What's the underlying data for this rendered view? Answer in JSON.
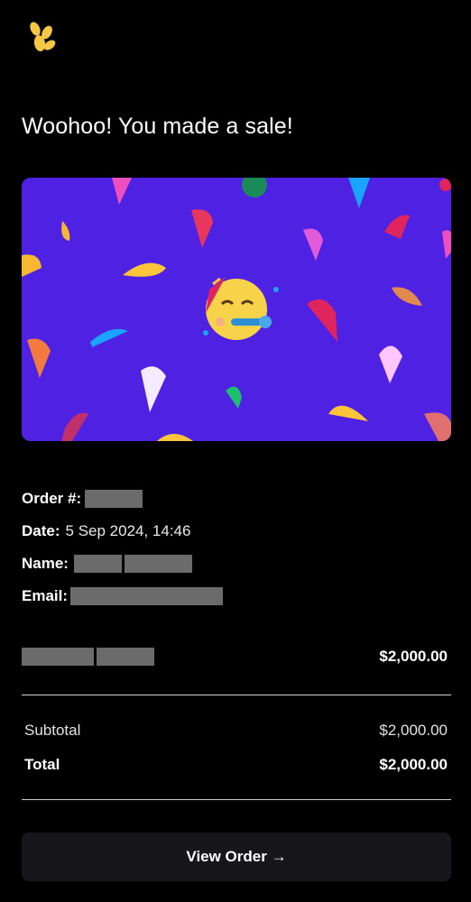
{
  "brand": {
    "logo_icon": "gumroad-star-logo-icon",
    "accent": "#f6c645"
  },
  "header": {
    "title": "Woohoo! You made a sale!"
  },
  "banner": {
    "background": "#4f22e3",
    "emoji_icon": "party-face-emoji-icon"
  },
  "order": {
    "order_label": "Order #:",
    "date_label": "Date:",
    "date_value": "5 Sep 2024, 14:46",
    "name_label": "Name:",
    "email_label": "Email:"
  },
  "line_item": {
    "price": "$2,000.00"
  },
  "summary": {
    "subtotal_label": "Subtotal",
    "subtotal_value": "$2,000.00",
    "total_label": "Total",
    "total_value": "$2,000.00"
  },
  "actions": {
    "view_order_label": "View Order →"
  }
}
